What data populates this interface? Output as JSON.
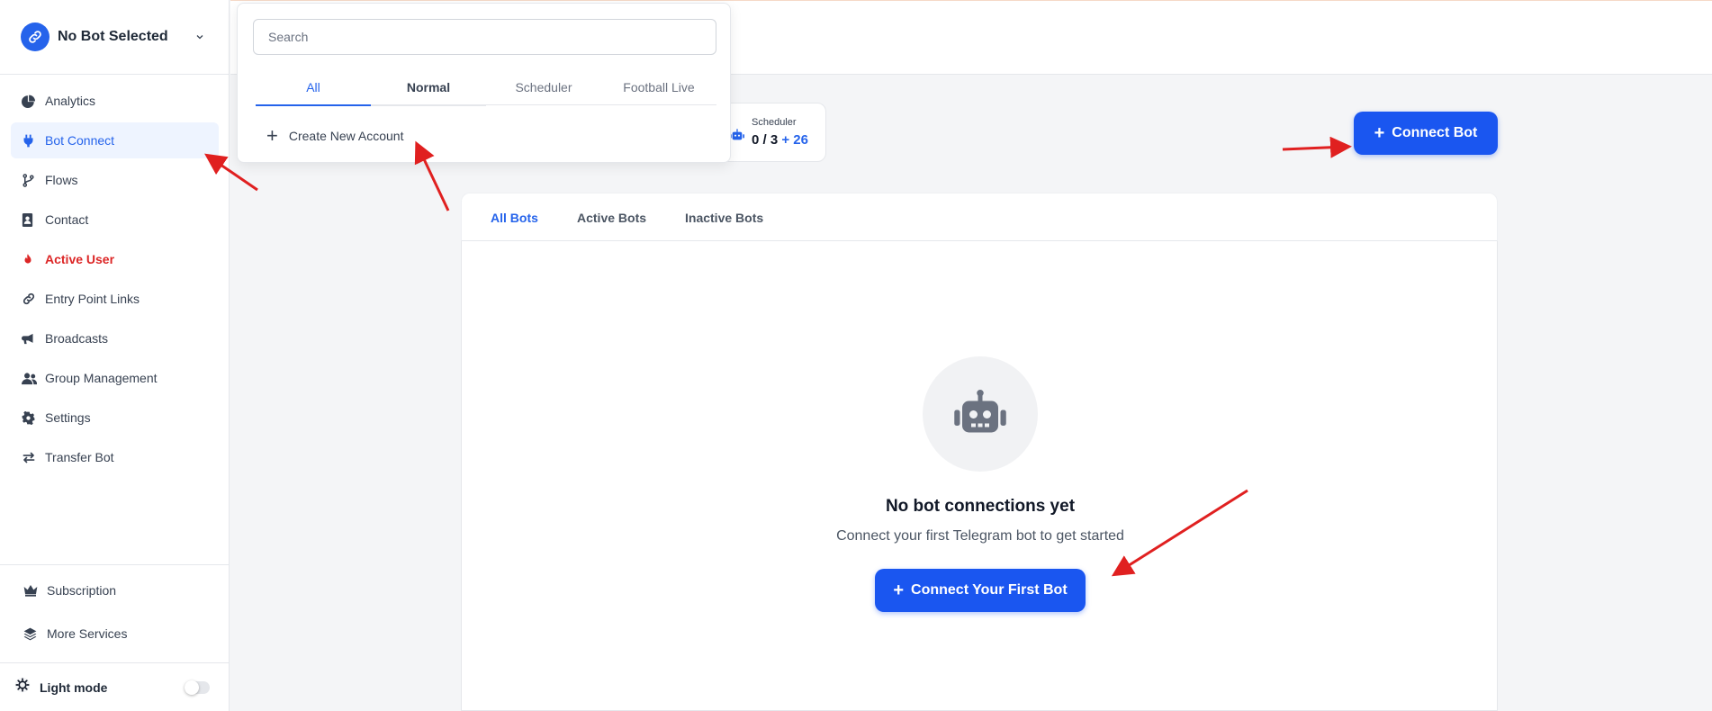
{
  "sidebar": {
    "bot_selector": {
      "label": "No Bot Selected"
    },
    "items": [
      {
        "label": "Analytics"
      },
      {
        "label": "Bot Connect"
      },
      {
        "label": "Flows"
      },
      {
        "label": "Contact"
      },
      {
        "label": "Active User"
      },
      {
        "label": "Entry Point Links"
      },
      {
        "label": "Broadcasts"
      },
      {
        "label": "Group Management"
      },
      {
        "label": "Settings"
      },
      {
        "label": "Transfer Bot"
      }
    ],
    "bottom_items": [
      {
        "label": "Subscription"
      },
      {
        "label": "More Services"
      }
    ],
    "theme_label": "Light mode"
  },
  "dropdown": {
    "search_placeholder": "Search",
    "tabs": [
      {
        "label": "All"
      },
      {
        "label": "Normal"
      },
      {
        "label": "Scheduler"
      },
      {
        "label": "Football Live"
      }
    ],
    "create_label": "Create New Account"
  },
  "stats": {
    "scheduler": {
      "label": "Scheduler",
      "value": "0 / 3",
      "extra": "+ 26"
    }
  },
  "header": {
    "connect_button": "Connect Bot"
  },
  "bot_tabs": [
    {
      "label": "All Bots"
    },
    {
      "label": "Active Bots"
    },
    {
      "label": "Inactive Bots"
    }
  ],
  "empty_state": {
    "title": "No bot connections yet",
    "subtitle": "Connect your first Telegram bot to get started",
    "button": "Connect Your First Bot"
  },
  "colors": {
    "accent": "#1a56f0",
    "active_user": "#dc2626",
    "annotation_arrow": "#e02020"
  }
}
